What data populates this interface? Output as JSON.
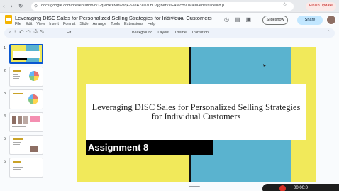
{
  "browser": {
    "url": "docs.google.com/presentation/d/1-qMBeYMBwxqk-SJeAZe070bDZjghetVxGArecB90MiedI/edit#slide=id.p",
    "finish_update": "Finish update"
  },
  "doc": {
    "title": "Leveraging DISC Sales for Personalized Selling Strategies for Individual Customers",
    "menus": [
      "File",
      "Edit",
      "View",
      "Insert",
      "Format",
      "Slide",
      "Arrange",
      "Tools",
      "Extensions",
      "Help"
    ],
    "slideshow": "Slideshow",
    "share": "Share"
  },
  "toolbar": {
    "zoom": "Fit",
    "actions": [
      "Background",
      "Layout",
      "Theme",
      "Transition"
    ]
  },
  "filmstrip": {
    "numbers": [
      "1",
      "2",
      "3",
      "4",
      "5",
      "6"
    ]
  },
  "slide": {
    "title": "Leveraging DISC Sales for Personalized Selling Strategies for Individual Customers",
    "subtitle": "Assignment 8",
    "colors": {
      "yellow": "#f1e95a",
      "blue": "#5ab3cf",
      "black": "#000000"
    }
  },
  "recorder": {
    "time": "00:00:0"
  }
}
